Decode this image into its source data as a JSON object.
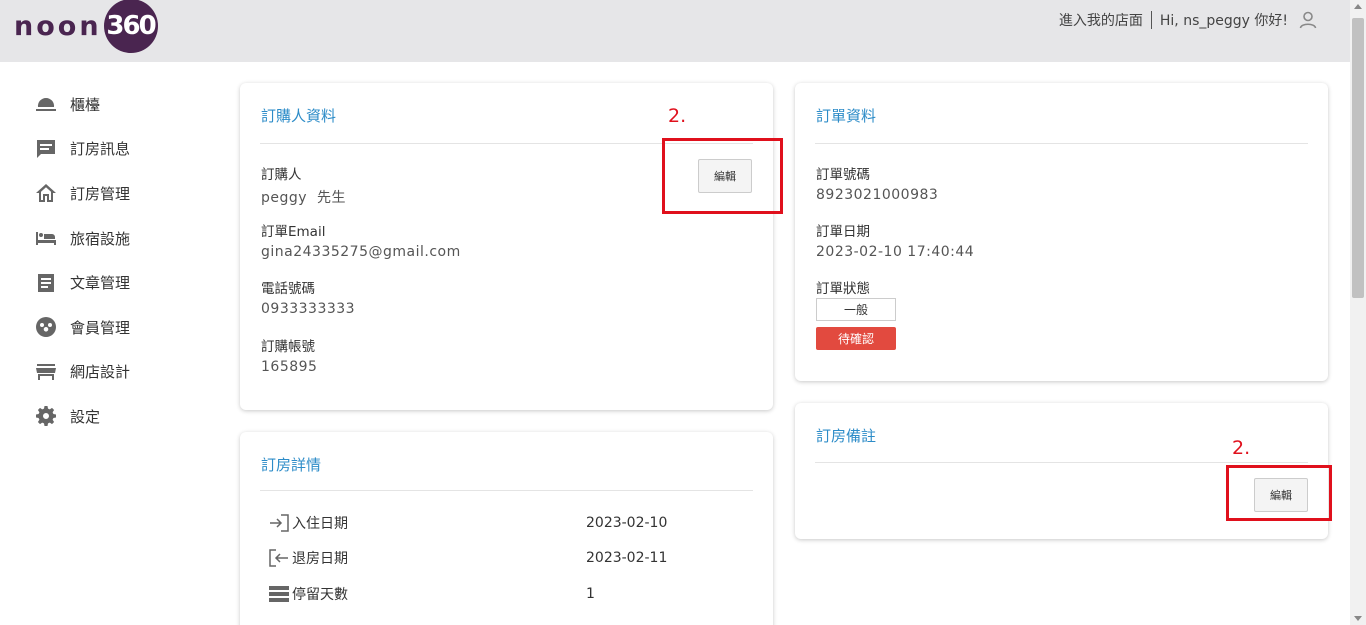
{
  "header": {
    "logo_text": "noon",
    "logo_badge": "360",
    "store_link": "進入我的店面",
    "greeting": "Hi, ns_peggy 你好!"
  },
  "sidebar": {
    "items": [
      {
        "label": "櫃檯",
        "icon": "counter-bell-icon"
      },
      {
        "label": "訂房訊息",
        "icon": "message-icon"
      },
      {
        "label": "訂房管理",
        "icon": "house-icon"
      },
      {
        "label": "旅宿設施",
        "icon": "bed-icon"
      },
      {
        "label": "文章管理",
        "icon": "article-icon"
      },
      {
        "label": "會員管理",
        "icon": "members-icon"
      },
      {
        "label": "網店設計",
        "icon": "store-icon"
      },
      {
        "label": "設定",
        "icon": "gear-icon"
      }
    ]
  },
  "orderer": {
    "title": "訂購人資料",
    "edit_label": "編輯",
    "name_label": "訂購人",
    "name_value": "peggy  先生",
    "email_label": "訂單Email",
    "email_value": "gina24335275@gmail.com",
    "phone_label": "電話號碼",
    "phone_value": "0933333333",
    "account_label": "訂購帳號",
    "account_value": "165895"
  },
  "order": {
    "title": "訂單資料",
    "number_label": "訂單號碼",
    "number_value": "8923021000983",
    "date_label": "訂單日期",
    "date_value": "2023-02-10 17:40:44",
    "status_label": "訂單狀態",
    "status_type": "一般",
    "status_badge": "待確認",
    "badge_color": "#e24a3f"
  },
  "remarks": {
    "title": "訂房備註",
    "edit_label": "編輯"
  },
  "details": {
    "title": "訂房詳情",
    "rows": [
      {
        "label": "入住日期",
        "value": "2023-02-10",
        "icon": "check-in-icon"
      },
      {
        "label": "退房日期",
        "value": "2023-02-11",
        "icon": "check-out-icon"
      },
      {
        "label": "停留天數",
        "value": "1",
        "icon": "nights-icon"
      }
    ]
  },
  "annotations": {
    "marker_1": "2.",
    "marker_2": "2.",
    "color": "#e0101c"
  }
}
